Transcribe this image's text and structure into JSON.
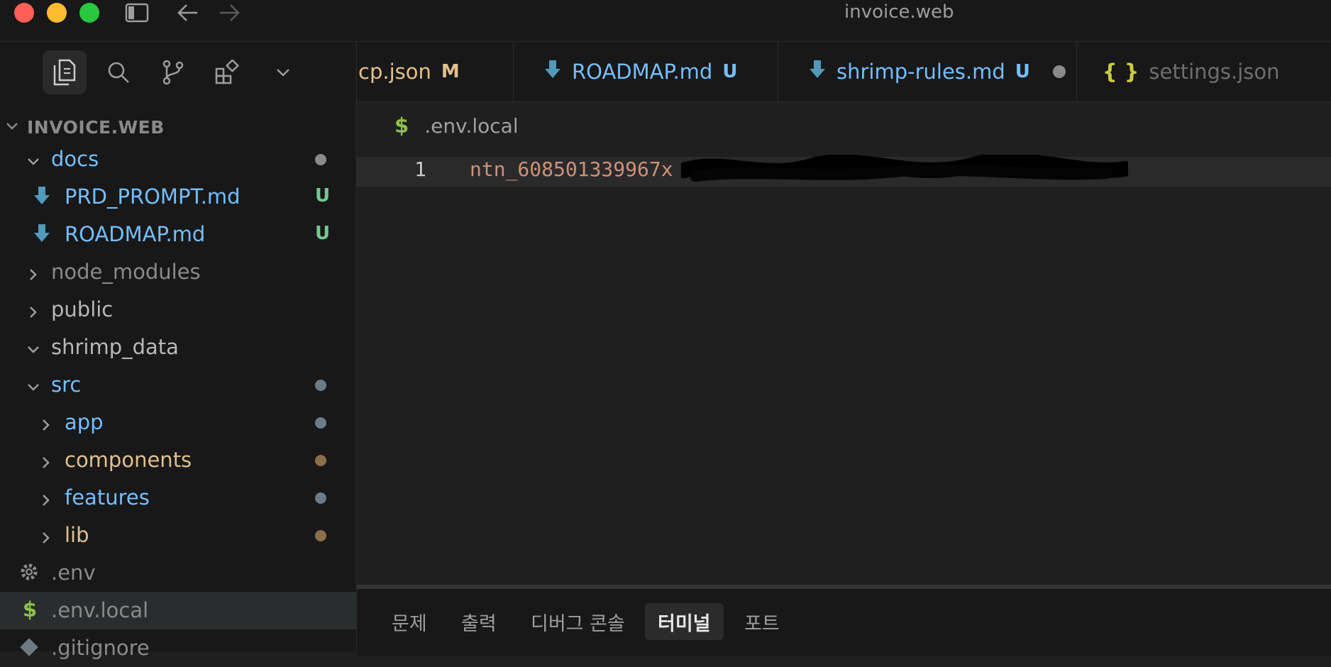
{
  "window": {
    "title": "invoice.web"
  },
  "activity_bar": {
    "icons": [
      "explorer-icon",
      "search-icon",
      "source-control-icon",
      "extensions-icon",
      "chevron-down-icon"
    ]
  },
  "explorer": {
    "title": "INVOICE.WEB",
    "tree": [
      {
        "label": "docs",
        "type": "folder",
        "expanded": true,
        "color": "#75beff",
        "status": "dot",
        "dot_color": "#8a8a8a"
      },
      {
        "label": "PRD_PROMPT.md",
        "type": "file",
        "color": "#75beff",
        "badge": "U"
      },
      {
        "label": "ROADMAP.md",
        "type": "file",
        "color": "#75beff",
        "badge": "U"
      },
      {
        "label": "node_modules",
        "type": "folder",
        "expanded": false,
        "color": "#8a8a8a"
      },
      {
        "label": "public",
        "type": "folder",
        "expanded": false,
        "color": "#b8b8b8"
      },
      {
        "label": "shrimp_data",
        "type": "folder",
        "expanded": true,
        "color": "#b8b8b8"
      },
      {
        "label": "src",
        "type": "folder",
        "expanded": true,
        "color": "#75beff",
        "dot_color": "#6a7d86"
      },
      {
        "label": "app",
        "type": "folder",
        "expanded": false,
        "color": "#75beff",
        "dot_color": "#6a7d86"
      },
      {
        "label": "components",
        "type": "folder",
        "expanded": false,
        "color": "#e2c08d",
        "dot_color": "#8a6f4a"
      },
      {
        "label": "features",
        "type": "folder",
        "expanded": false,
        "color": "#75beff",
        "dot_color": "#6a7d86"
      },
      {
        "label": "lib",
        "type": "folder",
        "expanded": false,
        "color": "#e2c08d",
        "dot_color": "#8a6f4a"
      },
      {
        "label": ".env",
        "type": "file",
        "color": "#8a8a8a"
      },
      {
        "label": ".env.local",
        "type": "file",
        "color": "#8a8a8a",
        "selected": true
      },
      {
        "label": ".gitignore",
        "type": "file",
        "color": "#8a8a8a"
      }
    ]
  },
  "tabs": [
    {
      "label": "mcp.json",
      "visible_label": "ıcp.json",
      "badge": "M",
      "color": "#e2c08d"
    },
    {
      "label": "ROADMAP.md",
      "badge": "U",
      "color": "#75beff"
    },
    {
      "label": "shrimp-rules.md",
      "badge": "U",
      "color": "#75beff",
      "dirty": true
    },
    {
      "label": "settings.json",
      "icon": "{ }",
      "color": "#6e6e6e"
    }
  ],
  "editor": {
    "breadcrumb": {
      "icon": "$",
      "label": ".env.local"
    },
    "line_number": "1",
    "line_text": "ntn_608501339967x"
  },
  "panel": {
    "tabs": [
      "문제",
      "출력",
      "디버그 콘솔",
      "터미널",
      "포트"
    ],
    "active": "터미널"
  }
}
